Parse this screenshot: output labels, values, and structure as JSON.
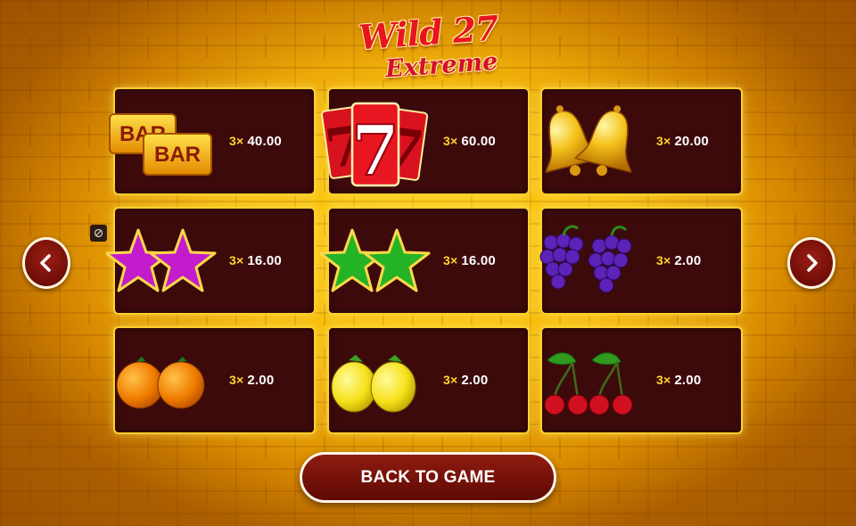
{
  "logo": {
    "line1": "Wild 27",
    "line2": "Extreme"
  },
  "paytable": [
    {
      "symbol": "bar",
      "icon": "bar-icon",
      "multiplier": "3×",
      "payout": "40.00"
    },
    {
      "symbol": "seven",
      "icon": "seven-icon",
      "multiplier": "3×",
      "payout": "60.00"
    },
    {
      "symbol": "bell",
      "icon": "bell-icon",
      "multiplier": "3×",
      "payout": "20.00"
    },
    {
      "symbol": "purple-star",
      "icon": "purple-star-icon",
      "multiplier": "3×",
      "payout": "16.00"
    },
    {
      "symbol": "green-star",
      "icon": "green-star-icon",
      "multiplier": "3×",
      "payout": "16.00"
    },
    {
      "symbol": "grapes",
      "icon": "grapes-icon",
      "multiplier": "3×",
      "payout": "2.00"
    },
    {
      "symbol": "orange",
      "icon": "orange-icon",
      "multiplier": "3×",
      "payout": "2.00"
    },
    {
      "symbol": "lemon",
      "icon": "lemon-icon",
      "multiplier": "3×",
      "payout": "2.00"
    },
    {
      "symbol": "cherry",
      "icon": "cherry-icon",
      "multiplier": "3×",
      "payout": "2.00"
    }
  ],
  "bar_symbol_text": [
    "BAR",
    "BAR"
  ],
  "seven_symbol_text": "7",
  "nav": {
    "prev_icon": "chevron-left-icon",
    "next_icon": "chevron-right-icon"
  },
  "back_button": {
    "label": "BACK TO GAME"
  },
  "colors": {
    "cell_bg": "#3d0a0b",
    "cell_border": "#ffcf2a",
    "multiplier": "#ffd62a",
    "button_bg": "#7a1209"
  }
}
